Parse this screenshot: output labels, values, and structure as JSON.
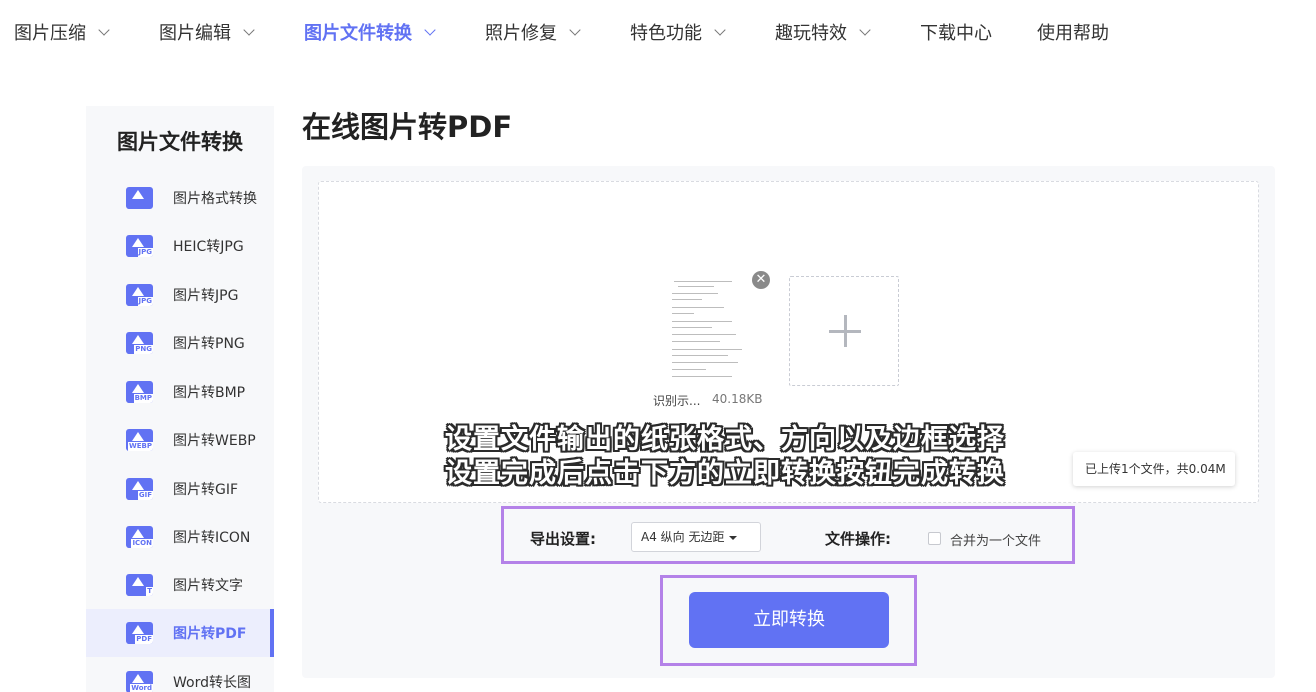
{
  "nav": {
    "items": [
      {
        "label": "图片压缩",
        "has_dropdown": true
      },
      {
        "label": "图片编辑",
        "has_dropdown": true
      },
      {
        "label": "图片文件转换",
        "has_dropdown": true,
        "active": true
      },
      {
        "label": "照片修复",
        "has_dropdown": true
      },
      {
        "label": "特色功能",
        "has_dropdown": true
      },
      {
        "label": "趣玩特效",
        "has_dropdown": true
      },
      {
        "label": "下载中心",
        "has_dropdown": false
      },
      {
        "label": "使用帮助",
        "has_dropdown": false
      }
    ]
  },
  "sidebar": {
    "title": "图片文件转换",
    "items": [
      {
        "label": "图片格式转换",
        "icon": "image-convert-icon",
        "tag": ""
      },
      {
        "label": "HEIC转JPG",
        "icon": "heic-jpg-icon",
        "tag": "JPG"
      },
      {
        "label": "图片转JPG",
        "icon": "jpg-icon",
        "tag": "JPG"
      },
      {
        "label": "图片转PNG",
        "icon": "png-icon",
        "tag": "PNG"
      },
      {
        "label": "图片转BMP",
        "icon": "bmp-icon",
        "tag": "BMP"
      },
      {
        "label": "图片转WEBP",
        "icon": "webp-icon",
        "tag": "WEBP"
      },
      {
        "label": "图片转GIF",
        "icon": "gif-icon",
        "tag": "GIF"
      },
      {
        "label": "图片转ICON",
        "icon": "icon-format-icon",
        "tag": "ICON"
      },
      {
        "label": "图片转文字",
        "icon": "text-icon",
        "tag": "T"
      },
      {
        "label": "图片转PDF",
        "icon": "pdf-icon",
        "tag": "PDF",
        "active": true
      },
      {
        "label": "Word转长图",
        "icon": "word-icon",
        "tag": "Word"
      }
    ]
  },
  "main": {
    "title": "在线图片转PDF",
    "file": {
      "name": "识别示...",
      "size": "40.18KB"
    },
    "upload_info": "已上传1个文件，共0.04M",
    "overlay": {
      "line1": "设置文件输出的纸张格式、方向以及边框选择",
      "line2": "设置完成后点击下方的立即转换按钮完成转换"
    },
    "settings": {
      "export_label": "导出设置:",
      "paper_value": "A4 纵向 无边距",
      "file_ops_label": "文件操作:",
      "merge_label": "合并为一个文件",
      "merge_checked": false
    },
    "convert_button": "立即转换"
  },
  "colors": {
    "accent": "#6172f3",
    "highlight_frame": "#b482e8"
  }
}
